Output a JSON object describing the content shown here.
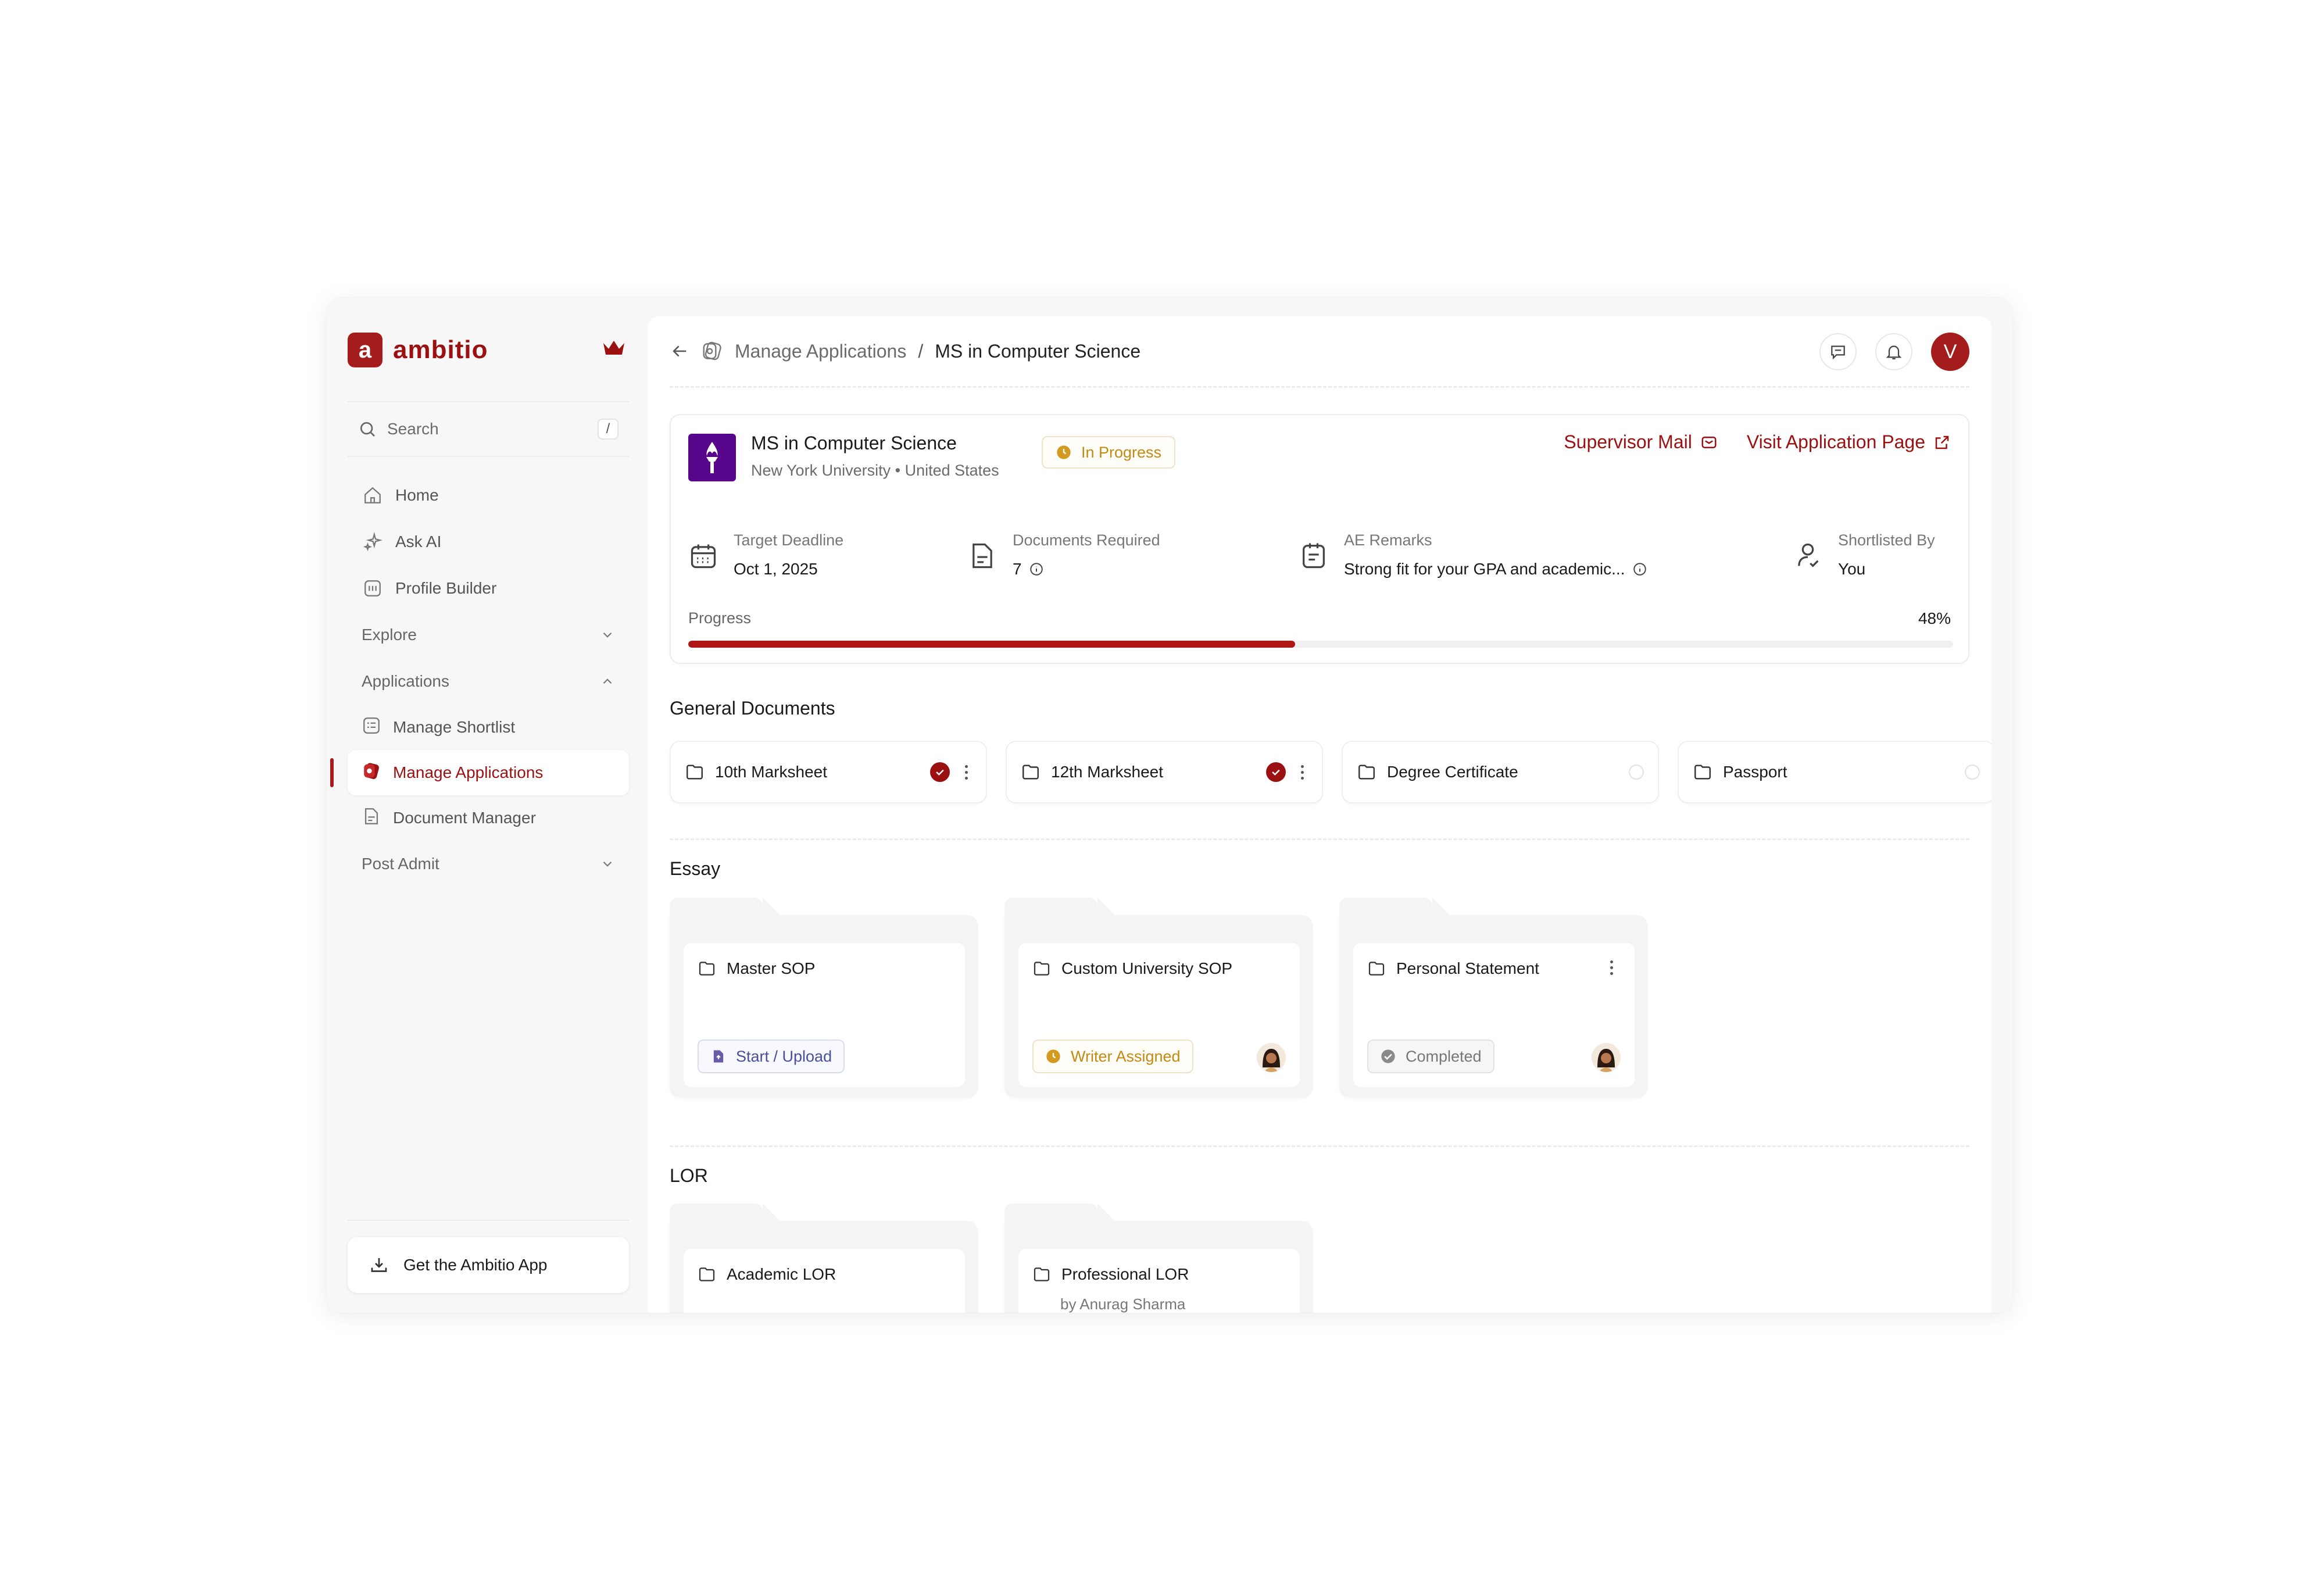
{
  "brand": {
    "name": "ambitio",
    "logo_letter": "a",
    "accent": "#9b1111"
  },
  "sidebar": {
    "search_label": "Search",
    "search_shortcut": "/",
    "items": [
      {
        "label": "Home",
        "icon": "home-icon"
      },
      {
        "label": "Ask AI",
        "icon": "sparkle-icon"
      },
      {
        "label": "Profile Builder",
        "icon": "profile-builder-icon"
      }
    ],
    "groups": {
      "explore": "Explore",
      "applications": "Applications",
      "post_admit": "Post Admit"
    },
    "application_items": [
      {
        "label": "Manage Shortlist",
        "icon": "shortlist-icon"
      },
      {
        "label": "Manage Applications",
        "icon": "applications-icon",
        "active": true
      },
      {
        "label": "Document Manager",
        "icon": "document-icon"
      }
    ],
    "get_app": "Get the Ambitio App"
  },
  "breadcrumb": {
    "parent": "Manage Applications",
    "separator": "/",
    "current": "MS in Computer Science"
  },
  "header": {
    "avatar_initial": "V"
  },
  "program": {
    "title": "MS in Computer Science",
    "university": "New York University",
    "dot": "•",
    "country": "United States",
    "status": "In Progress",
    "supervisor_mail": "Supervisor Mail",
    "visit_page": "Visit Application Page",
    "meta": {
      "deadline_label": "Target Deadline",
      "deadline_value": "Oct 1, 2025",
      "docs_label": "Documents Required",
      "docs_value": "7",
      "remarks_label": "AE Remarks",
      "remarks_value": "Strong fit for your GPA and academic...",
      "shortlisted_label": "Shortlisted By",
      "shortlisted_value": "You"
    },
    "progress_label": "Progress",
    "progress_text": "48%",
    "progress_value": 0.48
  },
  "sections": {
    "general": "General Documents",
    "essay": "Essay",
    "lor": "LOR"
  },
  "general_documents": [
    {
      "label": "10th Marksheet",
      "done": true
    },
    {
      "label": "12th Marksheet",
      "done": true
    },
    {
      "label": "Degree Certificate",
      "done": false
    },
    {
      "label": "Passport",
      "done": false
    }
  ],
  "essays": [
    {
      "title": "Master SOP",
      "status": "Start / Upload"
    },
    {
      "title": "Custom University SOP",
      "status": "Writer Assigned"
    },
    {
      "title": "Personal Statement",
      "status": "Completed"
    }
  ],
  "lors": [
    {
      "title": "Academic LOR"
    },
    {
      "title": "Professional LOR",
      "subtitle": "by Anurag Sharma"
    }
  ]
}
